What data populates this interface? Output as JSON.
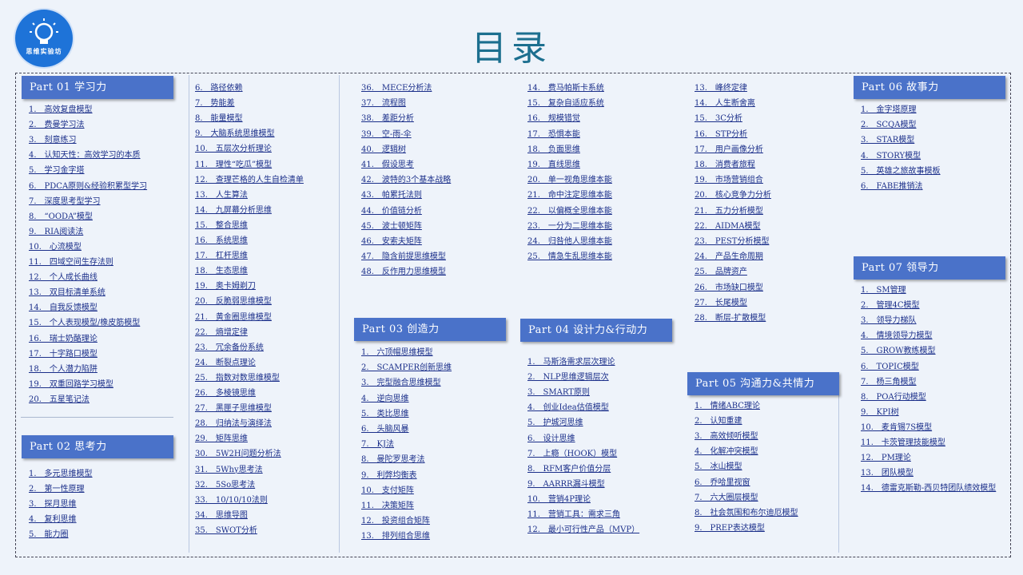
{
  "page": {
    "title": "目录"
  },
  "logo": {
    "text": "思维实验坊",
    "icon": "lightbulb-icon"
  },
  "parts": [
    {
      "id": "p1",
      "header": "Part 01  学习力",
      "items": [
        "1.　高效复盘模型",
        "2.　费曼学习法",
        "3.　刻意练习",
        "4.　认知天性：高效学习的本质",
        "5.　学习金字塔",
        "6.　PDCA原则&经验积累型学习",
        "7.　深度思考型学习",
        "8.　“OODA”模型",
        "9.　RIA阅读法",
        "10.　心流模型",
        "11.　四域空间生存法则",
        "12.　个人成长曲线",
        "13.　双目标清单系统",
        "14.　自我反馈模型",
        "15.　个人表现模型/橡皮筋模型",
        "16.　瑞士奶酪理论",
        "17.　十字路口模型",
        "18.　个人潜力陷阱",
        "19.　双重回路学习模型",
        "20.　五星笔记法"
      ]
    },
    {
      "id": "p2",
      "header": "Part 02  思考力",
      "items": [
        "1.　多元思维模型",
        "2.　第一性原理",
        "3.　探月思维",
        "4.　复利思维",
        "5.　能力圈"
      ]
    },
    {
      "id": "c2",
      "items": [
        "6.　路径依赖",
        "7.　势能差",
        "8.　能量模型",
        "9.　大脑系统思维模型",
        "10.　五层次分析理论",
        "11.　理性“吃瓜”模型",
        "12.　查理芒格的人生自检清单",
        "13.　人生算法",
        "14.　九屏幕分析思维",
        "15.　整合思维",
        "16.　系统思维",
        "17.　杠杆思维",
        "18.　生态思维",
        "19.　奥卡姆剃刀",
        "20.　反脆弱思维模型",
        "21.　黄金圈思维模型",
        "22.　熵增定律",
        "23.　冗余备份系统",
        "24.　断裂点理论",
        "25.　指数对数思维模型",
        "26.　多棱镜思维",
        "27.　黑匣子思维模型",
        "28.　归纳法与演绎法",
        "29.　矩阵思维",
        "30.　5W2H问题分析法",
        "31.　5Why思考法",
        "32.　5So思考法",
        "33.　10/10/10法则",
        "34.　思维导图",
        "35.　SWOT分析"
      ]
    },
    {
      "id": "c3",
      "items": [
        "36.　MECE分析法",
        "37.　流程图",
        "38.　差距分析",
        "39.　空-雨-伞",
        "40.　逻辑树",
        "41.　假设思考",
        "42.　波特的3个基本战略",
        "43.　帕累托法则",
        "44.　价值链分析",
        "45.　波士顿矩阵",
        "46.　安索夫矩阵",
        "47.　隐含前提思维模型",
        "48.　反作用力思维模型"
      ]
    },
    {
      "id": "p3",
      "header": "Part 03  创造力",
      "items": [
        "1.　六顶帽思维模型",
        "2.　SCAMPER创新思维",
        "3.　完型融合思维模型",
        "4.　逆向思维",
        "5.　类比思维",
        "6.　头脑风暴",
        "7.　KJ法",
        "8.　曼陀罗思考法",
        "9.　利弊均衡表",
        "10.　支付矩阵",
        "11.　决策矩阵",
        "12.　投资组合矩阵",
        "13.　排列组合思维"
      ]
    },
    {
      "id": "c4",
      "items": [
        "14.　费马帕斯卡系统",
        "15.　复杂自适应系统",
        "16.　规模错觉",
        "17.　恐惧本能",
        "18.　负面思维",
        "19.　直线思维",
        "20.　单一视角思维本能",
        "21.　命中注定思维本能",
        "22.　以偏概全思维本能",
        "23.　一分为二思维本能",
        "24.　归咎他人思维本能",
        "25.　情急生乱思维本能"
      ]
    },
    {
      "id": "p4",
      "header": "Part 04  设计力&行动力",
      "items": [
        "1.　马斯洛需求层次理论",
        "2.　NLP思维逻辑层次",
        "3.　SMART原则",
        "4.　创业Idea估值模型",
        "5.　护城河思维",
        "6.　设计思维",
        "7.　上瘾（HOOK）模型",
        "8.　RFM客户价值分层",
        "9.　AARRR漏斗模型",
        "10.　营销4P理论",
        "11.　营销工具：需求三角",
        "12.　最小可行性产品（MVP）"
      ]
    },
    {
      "id": "c5",
      "items": [
        "13.　峰终定律",
        "14.　人生断舍离",
        "15.　3C分析",
        "16.　STP分析",
        "17.　用户画像分析",
        "18.　消费者旅程",
        "19.　市场营销组合",
        "20.　核心竞争力分析",
        "21.　五力分析模型",
        "22.　AIDMA模型",
        "23.　PEST分析模型",
        "24.　产品生命周期",
        "25.　品牌资产",
        "26.　市场缺口模型",
        "27.　长尾模型",
        "28.　断层-扩散模型"
      ]
    },
    {
      "id": "p5",
      "header": "Part 05  沟通力&共情力",
      "items": [
        "1.　情绪ABC理论",
        "2.　认知重建",
        "3.　高效倾听模型",
        "4.　化解冲突模型",
        "5.　冰山模型",
        "6.　乔哈里视窗",
        "7.　六大圈层模型",
        "8.　社会氛围和布尔迪厄模型",
        "9.　PREP表达模型"
      ]
    },
    {
      "id": "p6",
      "header": "Part 06  故事力",
      "items": [
        "1.　金字塔原理",
        "2.　SCQA模型",
        "3.　STAR模型",
        "4.　STORY模型",
        "5.　英雄之旅故事模板",
        "6.　FABE推销法"
      ]
    },
    {
      "id": "p7",
      "header": "Part 07  领导力",
      "items": [
        "1.　SM管理",
        "2.　管理4C模型",
        "3.　领导力梯队",
        "4.　情境领导力模型",
        "5.　GROW教练模型",
        "6.　TOPIC模型",
        "7.　杨三角模型",
        "8.　POA行动模型",
        "9.　KPI树",
        "10.　麦肯锡7S模型",
        "11.　卡茨管理技能模型",
        "12.　PM理论",
        "13.　团队模型",
        "14.　德雷克斯勒-西贝特团队绩效模型"
      ]
    }
  ]
}
